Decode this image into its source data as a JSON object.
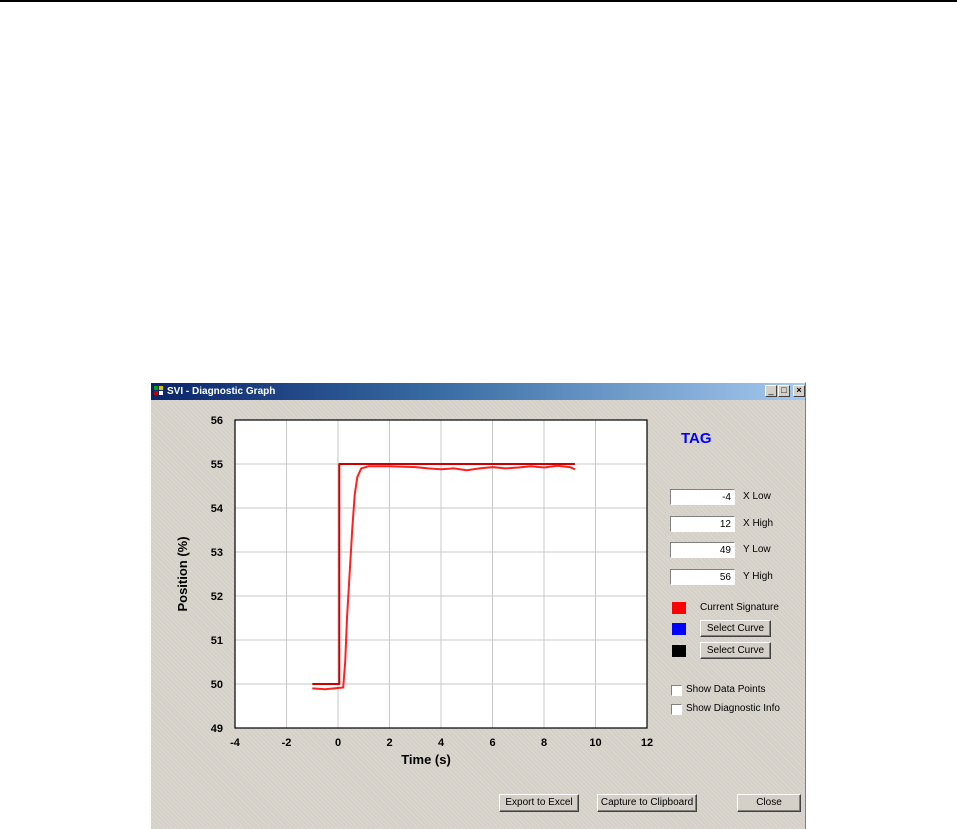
{
  "window": {
    "title": "SVI - Diagnostic Graph",
    "controls": {
      "minimize": "_",
      "maximize": "□",
      "close": "×"
    }
  },
  "tag": "TAG",
  "range_fields": [
    {
      "label": "X Low",
      "value": "-4"
    },
    {
      "label": "X High",
      "value": "12"
    },
    {
      "label": "Y Low",
      "value": "49"
    },
    {
      "label": "Y High",
      "value": "56"
    }
  ],
  "curves": [
    {
      "color": "#ff0000",
      "label": "Current Signature"
    },
    {
      "color": "#0000ff",
      "button": "Select Curve"
    },
    {
      "color": "#000000",
      "button": "Select Curve"
    }
  ],
  "checkboxes": {
    "show_data_points": {
      "label": "Show Data Points",
      "checked": false
    },
    "show_diagnostic_info": {
      "label": "Show Diagnostic Info",
      "checked": false
    }
  },
  "buttons": {
    "export": "Export to Excel",
    "capture": "Capture to Clipboard",
    "close": "Close"
  },
  "chart_data": {
    "type": "line",
    "xlabel": "Time (s)",
    "ylabel": "Position (%)",
    "xlim": [
      -4,
      12
    ],
    "ylim": [
      49,
      56
    ],
    "xticks": [
      -4,
      -2,
      0,
      2,
      4,
      6,
      8,
      10,
      12
    ],
    "yticks": [
      49,
      50,
      51,
      52,
      53,
      54,
      55,
      56
    ],
    "grid": true,
    "series": [
      {
        "color": "#cc0000",
        "x": [
          -1,
          0.05,
          0.05,
          9.2
        ],
        "y": [
          50,
          50,
          55,
          55
        ]
      },
      {
        "color": "#ff2020",
        "x": [
          -1,
          -0.5,
          0.2,
          0.28,
          0.35,
          0.45,
          0.55,
          0.65,
          0.75,
          0.9,
          1.2,
          2.0,
          3.0,
          3.5,
          4.0,
          4.5,
          5.0,
          5.5,
          6.0,
          6.5,
          7.0,
          7.5,
          8.0,
          8.5,
          9.0,
          9.2
        ],
        "y": [
          49.9,
          49.88,
          49.92,
          50.5,
          51.5,
          52.5,
          53.5,
          54.3,
          54.7,
          54.9,
          54.95,
          54.95,
          54.93,
          54.9,
          54.88,
          54.9,
          54.86,
          54.9,
          54.93,
          54.9,
          54.92,
          54.95,
          54.92,
          54.96,
          54.93,
          54.88
        ]
      }
    ]
  }
}
